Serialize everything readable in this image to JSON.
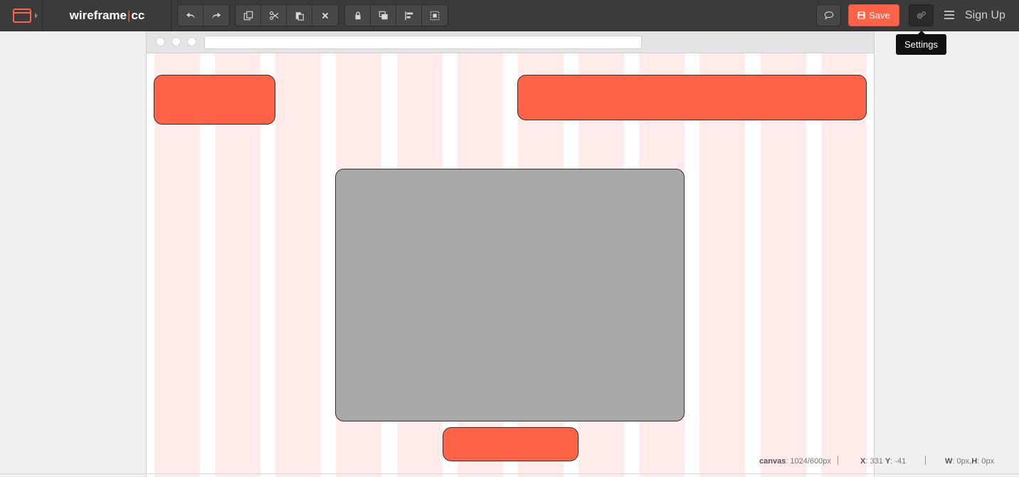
{
  "app": {
    "logo_left": "wireframe",
    "logo_sep": "|",
    "logo_right": "cc"
  },
  "toolbar": {
    "history": [
      "undo-icon",
      "redo-icon"
    ],
    "edit": [
      "copy-icon",
      "cut-icon",
      "paste-icon",
      "delete-icon"
    ],
    "arrange": [
      "lock-icon",
      "bring-to-front-icon",
      "align-icon",
      "group-icon"
    ],
    "save_label": "Save",
    "signup_label": "Sign Up",
    "tooltip": "Settings"
  },
  "colors": {
    "accent": "#ff6347",
    "toolbar": "#3b3b3b",
    "grid_column": "#ffecea",
    "placeholder_gray": "#a9a9a9"
  },
  "status": {
    "canvas_label": "canvas",
    "canvas_value": ": 1024/600px",
    "x_label": "X",
    "x_value": ": 331 ",
    "y_label": "Y",
    "y_value": ": -41",
    "w_label": "W",
    "w_value": ": 0px, ",
    "h_label": "H",
    "h_value": ": 0px"
  }
}
